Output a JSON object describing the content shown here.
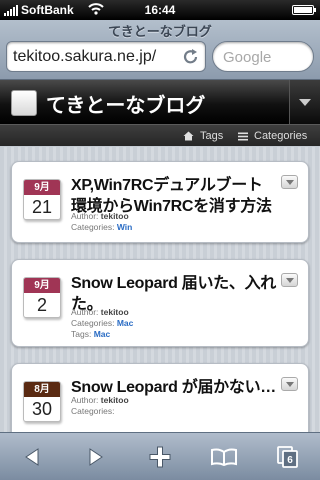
{
  "statusbar": {
    "carrier": "SoftBank",
    "time": "16:44"
  },
  "browser": {
    "page_title": "てきとーなブログ",
    "url": "tekitoo.sakura.ne.jp/",
    "search_placeholder": "Google"
  },
  "blog": {
    "title": "てきとーなブログ"
  },
  "subnav": {
    "tags": "Tags",
    "categories": "Categories"
  },
  "posts": [
    {
      "month": "9月",
      "day": "21",
      "month_color": "#a03555",
      "title": "XP,Win7RCデュアルブート環境からWin7RCを消す方法",
      "author_label": "Author: ",
      "author": "tekitoo",
      "categories_label": "Categories: ",
      "categories": "Win",
      "tags_label": "",
      "tags": ""
    },
    {
      "month": "9月",
      "day": "2",
      "month_color": "#a03555",
      "title": "Snow Leopard 届いた、入れた。",
      "author_label": "Author: ",
      "author": "tekitoo",
      "categories_label": "Categories: ",
      "categories": "Mac",
      "tags_label": "Tags: ",
      "tags": "Mac"
    },
    {
      "month": "8月",
      "day": "30",
      "month_color": "#5a2a12",
      "title": "Snow Leopard が届かない…",
      "author_label": "Author: ",
      "author": "tekitoo",
      "categories_label": "Categories: ",
      "categories": "",
      "tags_label": "",
      "tags": ""
    }
  ],
  "toolbar": {
    "tab_count": "6"
  }
}
